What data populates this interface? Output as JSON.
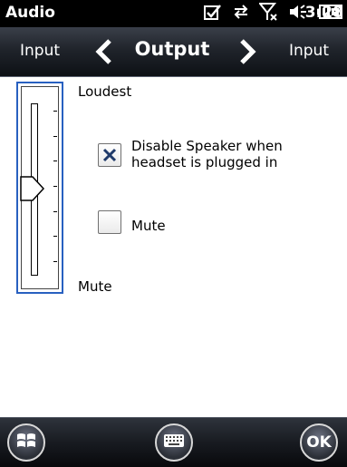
{
  "statusbar": {
    "title": "Audio",
    "time": "3:28",
    "icons": [
      "checkbox-icon",
      "sync-arrows-icon",
      "signal-off-icon",
      "speaker-icon",
      "battery-icon"
    ]
  },
  "tabs": {
    "prev": "Input",
    "current": "Output",
    "next": "Input"
  },
  "volume": {
    "label_top": "Loudest",
    "label_bottom": "Mute",
    "level_fraction": 0.5,
    "tick_count": 7
  },
  "options": {
    "disable_speaker": {
      "label_line1": "Disable Speaker when",
      "label_line2": "headset is plugged in",
      "checked": true
    },
    "mute": {
      "label": "Mute",
      "checked": false
    }
  },
  "bottombar": {
    "ok_label": "OK",
    "icons": [
      "windows-start-icon",
      "keyboard-icon"
    ]
  },
  "colors": {
    "frame_border": "#2860c0",
    "bar_dark": "#0d1015"
  }
}
